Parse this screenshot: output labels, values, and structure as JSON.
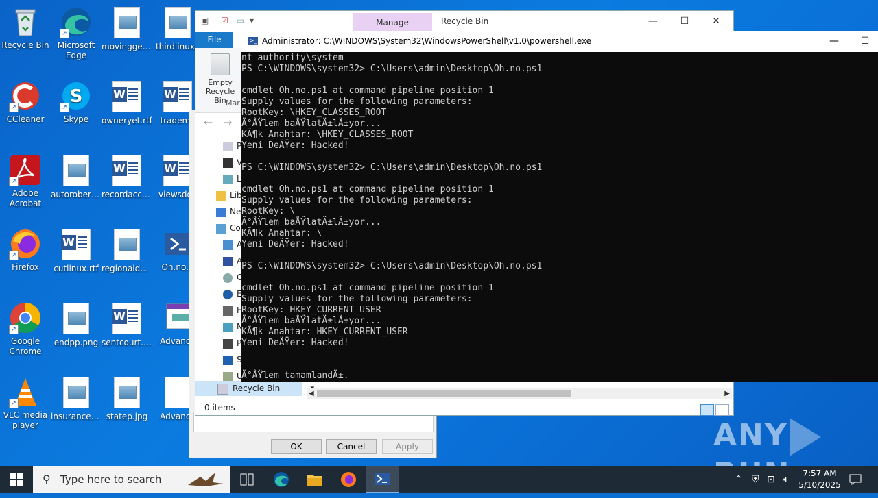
{
  "desktop": {
    "icons": [
      {
        "label": "Recycle Bin",
        "kind": "recycle-bin"
      },
      {
        "label": "Microsoft Edge",
        "kind": "edge"
      },
      {
        "label": "movingget....",
        "kind": "image-file"
      },
      {
        "label": "thirdlinux.j",
        "kind": "image-file"
      },
      {
        "label": "CCleaner",
        "kind": "ccleaner"
      },
      {
        "label": "Skype",
        "kind": "skype"
      },
      {
        "label": "owneryet.rtf",
        "kind": "word-file"
      },
      {
        "label": "tradema",
        "kind": "word-file"
      },
      {
        "label": "Adobe Acrobat",
        "kind": "acrobat"
      },
      {
        "label": "autorobert....",
        "kind": "image-file"
      },
      {
        "label": "recordacc....",
        "kind": "word-file"
      },
      {
        "label": "viewsdov",
        "kind": "word-file"
      },
      {
        "label": "Firefox",
        "kind": "firefox"
      },
      {
        "label": "cutlinux.rtf",
        "kind": "word-file"
      },
      {
        "label": "regionalda...",
        "kind": "image-file"
      },
      {
        "label": "Oh.no.p",
        "kind": "powershell-file"
      },
      {
        "label": "Google Chrome",
        "kind": "chrome"
      },
      {
        "label": "endpp.png",
        "kind": "image-file"
      },
      {
        "label": "sentcourt.rtf",
        "kind": "word-file"
      },
      {
        "label": "Advance",
        "kind": "installer"
      },
      {
        "label": "VLC media player",
        "kind": "vlc"
      },
      {
        "label": "insurances....",
        "kind": "image-file"
      },
      {
        "label": "statep.jpg",
        "kind": "image-file"
      },
      {
        "label": "Advance",
        "kind": "blank-file"
      }
    ]
  },
  "explorer": {
    "manage_tab": "Manage",
    "title": "Recycle Bin",
    "file_tab": "File",
    "empty_bin_label": "Empty Recycle Bin",
    "group_label": "Mar",
    "nav_items": [
      "P",
      "V",
      "L",
      "Lib",
      "Ne",
      "Co",
      "A",
      "A",
      "C",
      "E",
      "H",
      "N",
      "P",
      "S",
      "U"
    ],
    "selected_nav": "Recycle Bin",
    "status": "0 items"
  },
  "dialog": {
    "ok": "OK",
    "cancel": "Cancel",
    "apply": "Apply"
  },
  "powershell": {
    "title": "Administrator: C:\\WINDOWS\\System32\\WindowsPowerShell\\v1.0\\powershell.exe",
    "lines": [
      "nt authority\\system",
      "PS C:\\WINDOWS\\system32> C:\\Users\\admin\\Desktop\\Oh.no.ps1",
      "",
      "cmdlet Oh.no.ps1 at command pipeline position 1",
      "Supply values for the following parameters:",
      "RootKey: \\HKEY_CLASSES_ROOT",
      "Ä°ÅŸlem baÅŸlatÄ±lÄ±yor...",
      "KÃ¶k Anahtar: \\HKEY_CLASSES_ROOT",
      "Yeni DeÄŸer: Hacked!",
      "",
      "PS C:\\WINDOWS\\system32> C:\\Users\\admin\\Desktop\\Oh.no.ps1",
      "",
      "cmdlet Oh.no.ps1 at command pipeline position 1",
      "Supply values for the following parameters:",
      "RootKey: \\",
      "Ä°ÅŸlem baÅŸlatÄ±lÄ±yor...",
      "KÃ¶k Anahtar: \\",
      "Yeni DeÄŸer: Hacked!",
      "",
      "PS C:\\WINDOWS\\system32> C:\\Users\\admin\\Desktop\\Oh.no.ps1",
      "",
      "cmdlet Oh.no.ps1 at command pipeline position 1",
      "Supply values for the following parameters:",
      "RootKey: HKEY_CURRENT_USER",
      "Ä°ÅŸlem baÅŸlatÄ±lÄ±yor...",
      "KÃ¶k Anahtar: HKEY_CURRENT_USER",
      "Yeni DeÄŸer: Hacked!",
      "",
      "",
      "Ä°ÅŸlem tamamlandÄ±."
    ]
  },
  "watermark": {
    "left": "ANY",
    "right": "RUN"
  },
  "taskbar": {
    "search_placeholder": "Type here to search",
    "apps": [
      "task-view",
      "edge",
      "file-explorer",
      "firefox",
      "powershell"
    ],
    "time": "7:57 AM",
    "date": "5/10/2025"
  },
  "colors": {
    "desktop": "#0a6fd0",
    "console_bg": "#0c0c0c",
    "console_text": "#cccccc",
    "manage_tab": "#e8d1f2",
    "file_tab": "#1979ca",
    "taskbar": "#1f2a37"
  }
}
